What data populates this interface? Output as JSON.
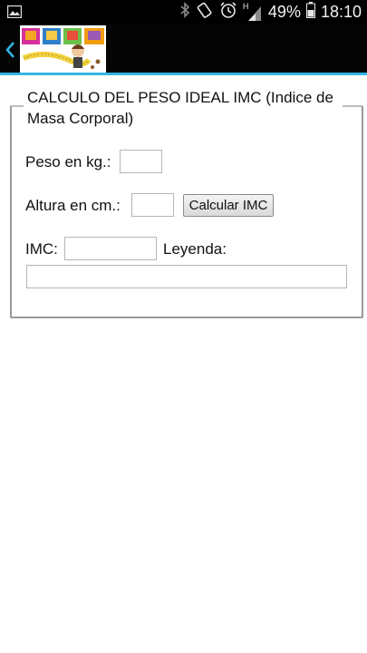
{
  "status_bar": {
    "battery": "49%",
    "time": "18:10",
    "network_type": "H",
    "icons": [
      "gallery-icon",
      "bluetooth-icon",
      "rotation-icon",
      "alarm-icon",
      "signal-icon",
      "battery-icon"
    ]
  },
  "action_bar": {
    "back_icon": "chevron-left-icon",
    "accent_color": "#33b5e5"
  },
  "form": {
    "legend": "CALCULO DEL PESO IDEAL IMC (Indice de Masa Corporal)",
    "peso_label": "Peso en kg.:",
    "peso_value": "",
    "altura_label": "Altura en cm.:",
    "altura_value": "",
    "calc_button": "Calcular IMC",
    "imc_label": "IMC:",
    "imc_value": "",
    "leyenda_label": "Leyenda:",
    "leyenda_value": ""
  }
}
